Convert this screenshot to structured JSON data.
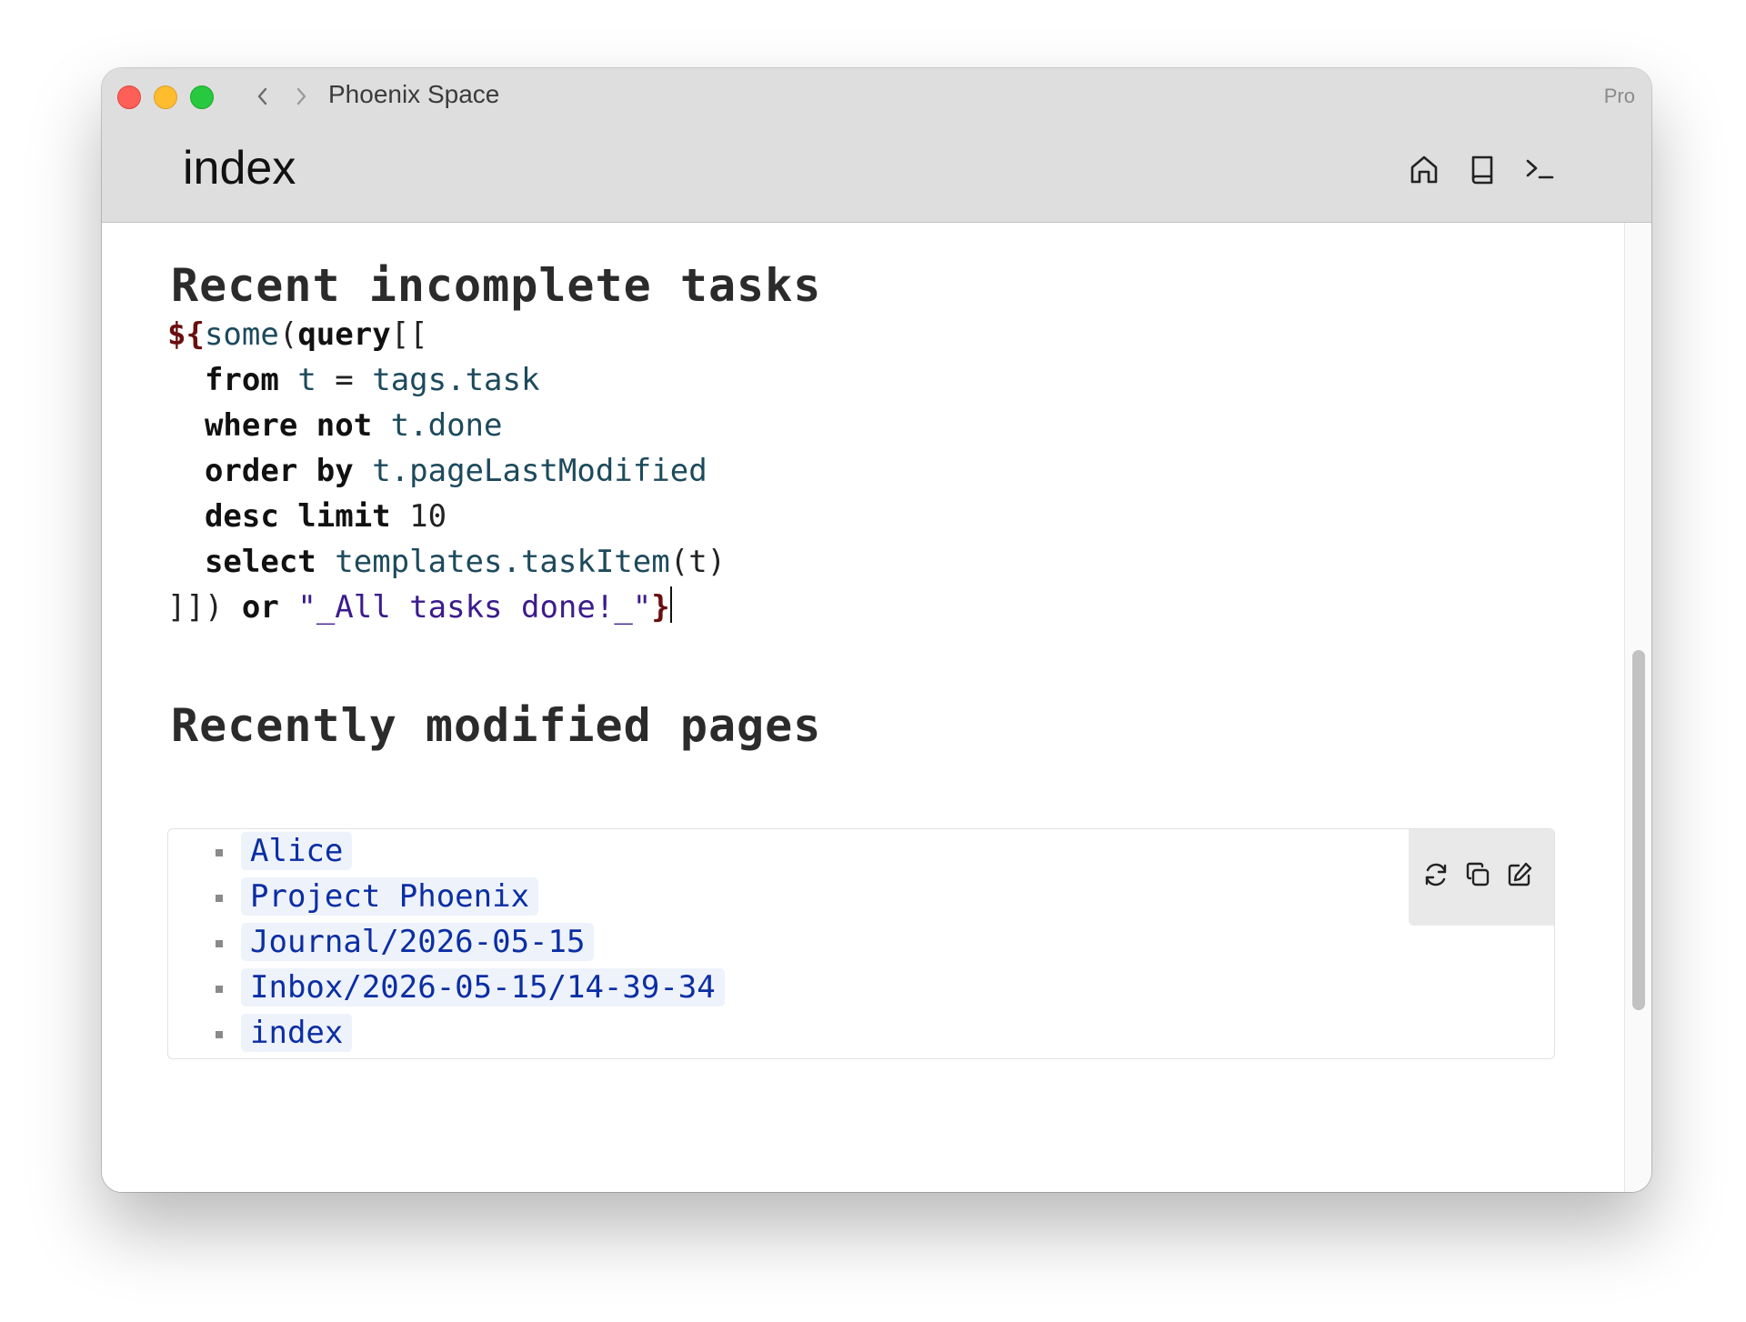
{
  "window": {
    "space_title": "Phoenix Space",
    "pro_label": "Pro",
    "page_name": "index",
    "traffic_colors": {
      "close": "#fe5f57",
      "minimize": "#febc2e",
      "zoom": "#28c840"
    }
  },
  "toolbar": {
    "icons": [
      "home-icon",
      "book-icon",
      "terminal-icon"
    ]
  },
  "sections": {
    "tasks_heading": "Recent incomplete tasks",
    "pages_heading": "Recently modified pages"
  },
  "code": {
    "l1_tpl": "${",
    "l1_fn": "some",
    "l1_p": "(",
    "l1_kw": "query",
    "l1_b": "[[",
    "l2_kw": "from",
    "l2_var": "t",
    "l2_op": " = ",
    "l2_val": "tags.task",
    "l3_kw": "where not",
    "l3_val": "t.done",
    "l4_kw": "order by",
    "l4_val": "t.pageLastModified",
    "l5_kw": "desc limit",
    "l5_num": "10",
    "l6_kw": "select",
    "l6_fn": "templates.taskItem",
    "l6_args": "(t)",
    "l7_b": "]])",
    "l7_kw": "or",
    "l7_str": "\"_All tasks done!_\"",
    "l7_tpl": "}"
  },
  "pages": [
    {
      "label": "Alice"
    },
    {
      "label": "Project Phoenix"
    },
    {
      "label": "Journal/2026-05-15"
    },
    {
      "label": "Inbox/2026-05-15/14-39-34"
    },
    {
      "label": "index"
    }
  ],
  "list_tools": [
    "refresh-icon",
    "copy-icon",
    "edit-icon"
  ],
  "colors": {
    "link": "#0b2ea3",
    "link_bg": "#eef2fa",
    "titlebar": "#dedede"
  }
}
